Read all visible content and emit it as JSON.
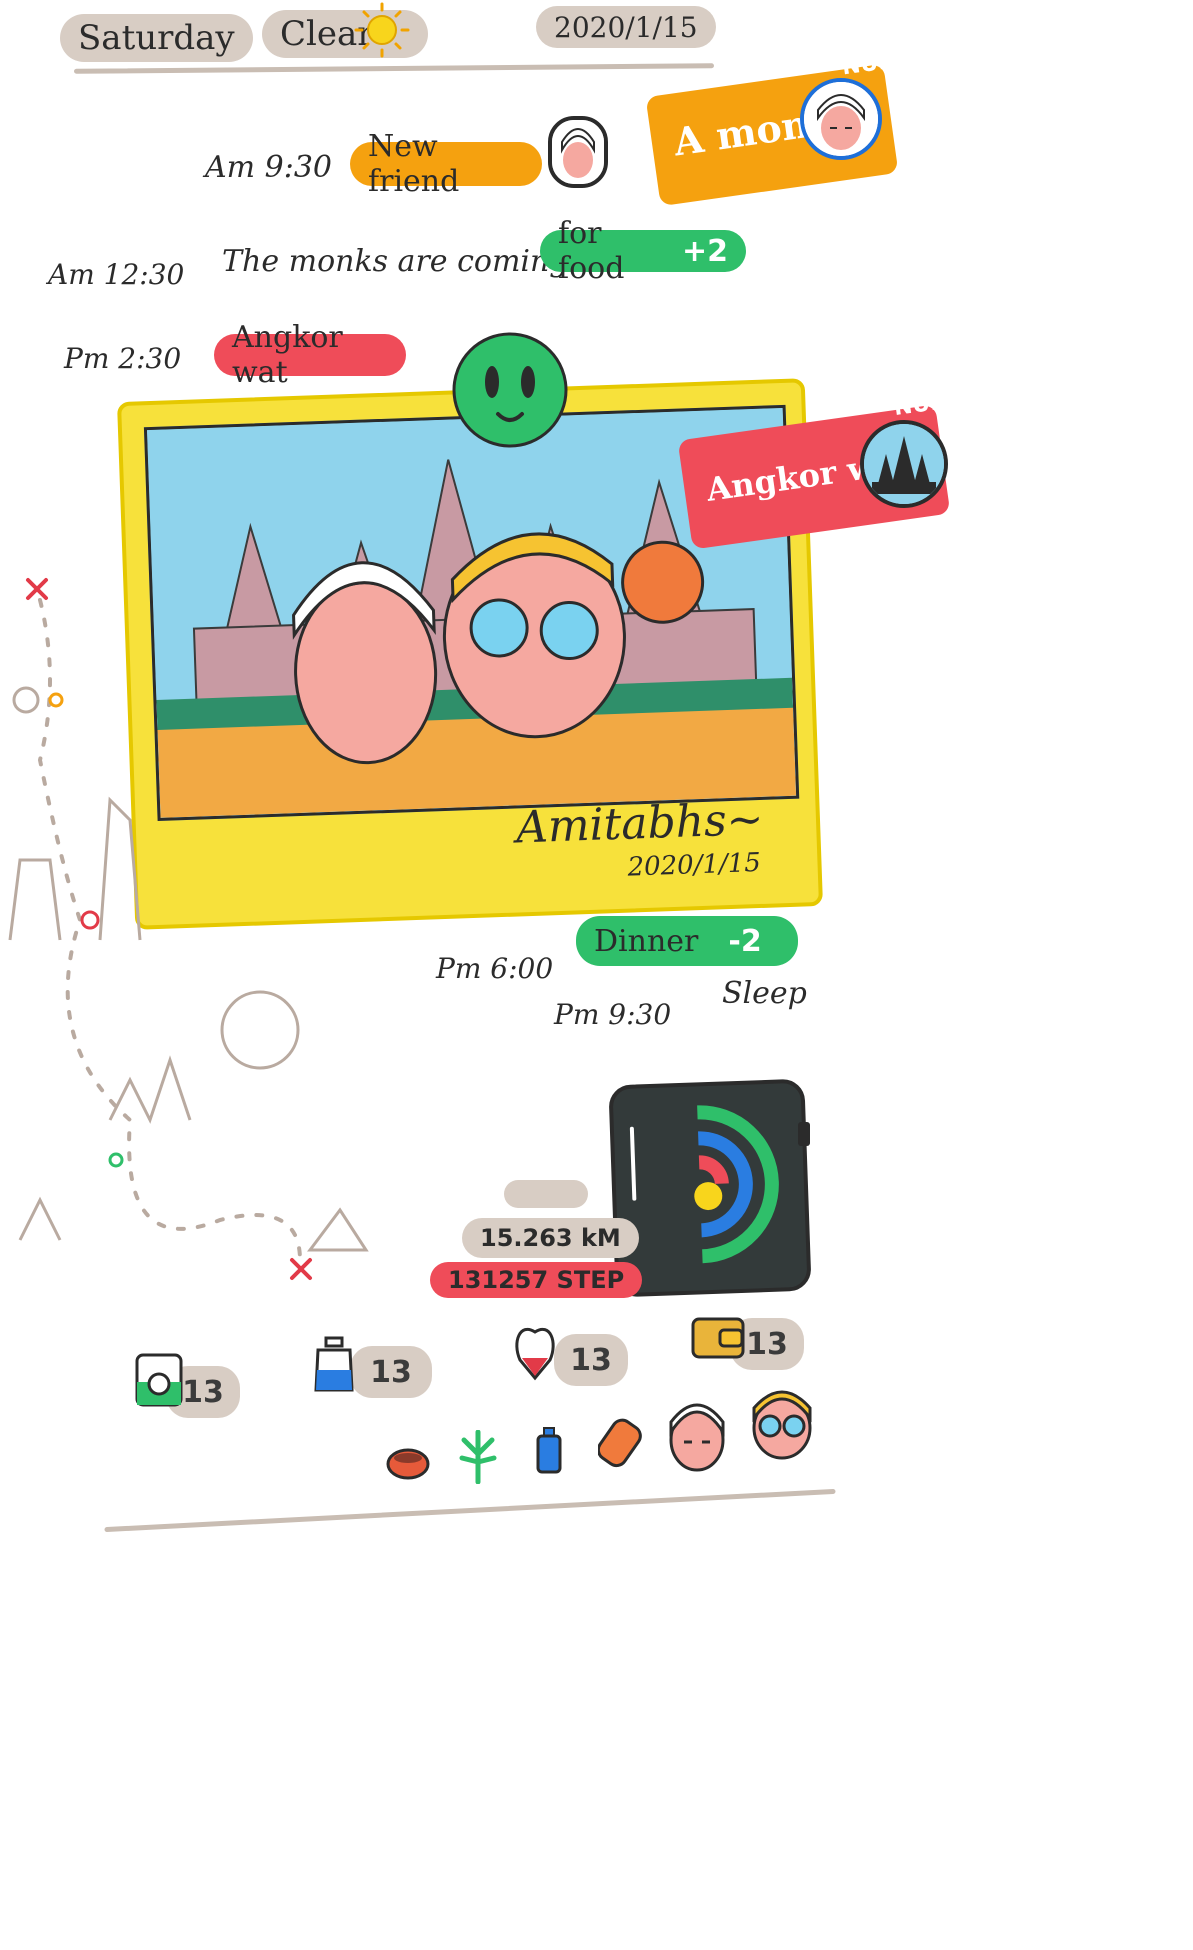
{
  "header": {
    "day": "Saturday",
    "weather": "Clear",
    "date": "2020/1/15"
  },
  "timeline": [
    {
      "time": "Am 9:30",
      "label": "New friend",
      "color": "#f5a10f"
    },
    {
      "time": "Am 12:30",
      "text": "The monks are coming",
      "label": "for food",
      "delta": "+2",
      "color": "#2fbf6a"
    },
    {
      "time": "Pm 2:30",
      "label": "Angkor wat",
      "color": "#ef4c59"
    },
    {
      "time": "Pm 6:00",
      "label": "Dinner",
      "delta": "-2",
      "color": "#2fbf6a"
    },
    {
      "time": "Pm 9:30",
      "text": "Sleep"
    }
  ],
  "badges": {
    "monk": {
      "label": "A monk",
      "corner": "NUE",
      "color": "#f5a10f"
    },
    "angkor": {
      "label": "Angkor wat",
      "corner": "NUE",
      "color": "#ef4c59"
    }
  },
  "photo": {
    "caption": "Amitabhs~",
    "date": "2020/1/15"
  },
  "stats": {
    "distance": "15.263 kM",
    "steps": "131257 STEP"
  },
  "inventory": [
    {
      "icon": "washing-machine-icon",
      "count": "13"
    },
    {
      "icon": "water-bottle-icon",
      "count": "13"
    },
    {
      "icon": "heart-organ-icon",
      "count": "13"
    },
    {
      "icon": "wallet-icon",
      "count": "13"
    }
  ],
  "items": [
    "bowl-icon",
    "plant-icon",
    "bottle-icon",
    "sleeping-mat-icon",
    "monk-avatar-icon",
    "traveler-avatar-icon"
  ]
}
